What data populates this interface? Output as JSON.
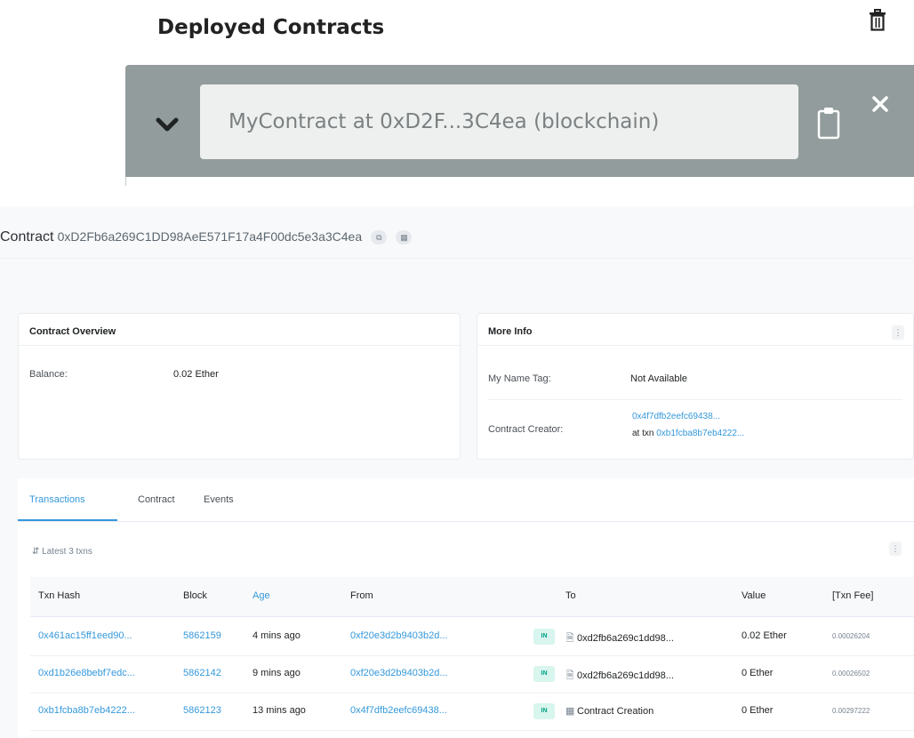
{
  "remix": {
    "title": "Deployed Contracts",
    "instance_label": "MyContract at 0xD2F...3C4ea (blockchain)"
  },
  "etherscan": {
    "header_label": "Contract",
    "header_address": "0xD2Fb6a269C1DD98AeE571F17a4F00dc5e3a3C4ea",
    "overview": {
      "title": "Contract Overview",
      "balance_key": "Balance:",
      "balance_value": "0.02 Ether"
    },
    "more_info": {
      "title": "More Info",
      "name_tag_key": "My Name Tag:",
      "name_tag_value": "Not Available",
      "creator_key": "Contract Creator:",
      "creator_address": "0x4f7dfb2eefc69438...",
      "creator_at_prefix": "at txn",
      "creator_txn": "0xb1fcba8b7eb4222..."
    },
    "tabs": [
      "Transactions",
      "Contract",
      "Events"
    ],
    "latest_label": "Latest 3 txns",
    "columns": [
      "Txn Hash",
      "Block",
      "Age",
      "From",
      "To",
      "Value",
      "[Txn Fee]"
    ],
    "rows": [
      {
        "hash": "0x461ac15ff1eed90...",
        "block": "5862159",
        "age": "4 mins ago",
        "from": "0xf20e3d2b9403b2d...",
        "direction": "IN",
        "to_icon": "document-icon",
        "to": "0xd2fb6a269c1dd98...",
        "value": "0.02 Ether",
        "fee": "0.00026204"
      },
      {
        "hash": "0xd1b26e8bebf7edc...",
        "block": "5862142",
        "age": "9 mins ago",
        "from": "0xf20e3d2b9403b2d...",
        "direction": "IN",
        "to_icon": "document-icon",
        "to": "0xd2fb6a269c1dd98...",
        "value": "0 Ether",
        "fee": "0.00026502"
      },
      {
        "hash": "0xb1fcba8b7eb4222...",
        "block": "5862123",
        "age": "13 mins ago",
        "from": "0x4f7dfb2eefc69438...",
        "direction": "IN",
        "to_icon": "contract-creation-icon",
        "to": "Contract Creation",
        "value": "0 Ether",
        "fee": "0.00297222"
      }
    ]
  },
  "colors": {
    "remix_bar": "#939c9c",
    "link": "#3498db",
    "in_badge_bg": "#d8f5ee",
    "in_badge_text": "#00a186"
  }
}
